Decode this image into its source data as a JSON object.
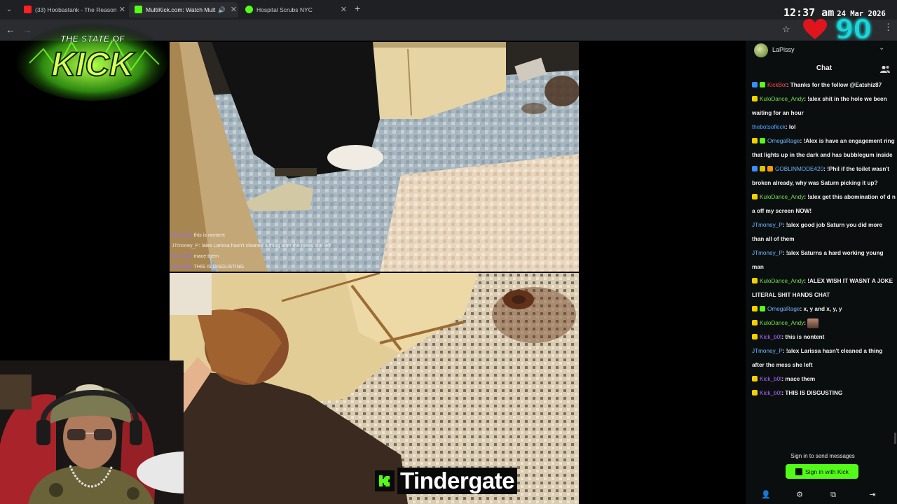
{
  "browser": {
    "tabs": [
      {
        "label": "(33) Hoobastank - The Reason",
        "favicon_color": "#ff2020"
      },
      {
        "label": "MultiKick.com: Watch Mult",
        "favicon_color": "#53fc18",
        "active": true
      },
      {
        "label": "Hospital Scrubs NYC",
        "favicon_color": "#53fc18"
      }
    ]
  },
  "overlay": {
    "time": "12:37 am",
    "date": "24 Mar 2026",
    "counter": "90"
  },
  "logo": {
    "line1": "THE STATE OF",
    "line2": "KICK"
  },
  "video_chat_overlay": [
    {
      "user": "Kick_b0t:",
      "text": "this is nontent"
    },
    {
      "user": "JTmoney_P:",
      "text": "!alex Larissa hasn't cleaned a thing after the mess she left"
    },
    {
      "user": "Kick_b0t:",
      "text": "mace them"
    },
    {
      "user": "Kick_b0t:",
      "text": "THIS IS DISGUSTING"
    }
  ],
  "stream_tag": "Tindergate",
  "chat": {
    "channel": "LaPissy",
    "title": "Chat",
    "messages": [
      {
        "user": "KickBot",
        "color": "red",
        "badges": [
          "b-blue",
          "b-green"
        ],
        "text": "Thanks for the follow @Eatshiz87"
      },
      {
        "user": "KuloDance_Andy",
        "color": "green",
        "badges": [
          "b-yellow"
        ],
        "text": "!alex shit in the hole we been waiting for an hour"
      },
      {
        "user": "thebotsofkick",
        "color": "blue",
        "badges": [],
        "text": "lol"
      },
      {
        "user": "OmegaRage",
        "color": "teal",
        "badges": [
          "b-yellow",
          "b-green"
        ],
        "text": "!Alex is have an engagement ring that lights up in the dark and has bubblegum inside"
      },
      {
        "user": "GOBLINMODE420",
        "color": "teal",
        "badges": [
          "b-blue",
          "b-gold",
          "b-orange"
        ],
        "text": "!Phil if the toilet wasn't broken already, why was Saturn picking it up?"
      },
      {
        "user": "KuloDance_Andy",
        "color": "green",
        "badges": [
          "b-yellow"
        ],
        "text": "!alex get this abomination of d n a off my screen NOW!"
      },
      {
        "user": "JTmoney_P",
        "color": "teal",
        "badges": [],
        "text": "!alex good job Saturn you did more than all of them"
      },
      {
        "user": "JTmoney_P",
        "color": "teal",
        "badges": [],
        "text": "!alex Saturns a hard working young man"
      },
      {
        "user": "KuloDance_Andy",
        "color": "green",
        "badges": [
          "b-yellow"
        ],
        "text": "!ALEX WISH IT WASNT A JOKE LITERAL SHIT HANDS CHAT"
      },
      {
        "user": "OmegaRage",
        "color": "teal",
        "badges": [
          "b-yellow",
          "b-green"
        ],
        "text": "x, y and x, y, y"
      },
      {
        "user": "KuloDance_Andy",
        "color": "green",
        "badges": [
          "b-yellow"
        ],
        "text": "",
        "emote": true
      },
      {
        "user": "Kick_b0t",
        "color": "purple",
        "badges": [
          "b-yellow"
        ],
        "text": "this is nontent"
      },
      {
        "user": "JTmoney_P",
        "color": "teal",
        "badges": [],
        "text": "!alex Larissa hasn't cleaned a thing after the mess she left"
      },
      {
        "user": "Kick_b0t",
        "color": "purple",
        "badges": [
          "b-yellow"
        ],
        "text": "mace them"
      },
      {
        "user": "Kick_b0t",
        "color": "purple",
        "badges": [
          "b-yellow"
        ],
        "text": "THIS IS DISGUSTING"
      }
    ],
    "signin_prompt": "Sign in to send messages",
    "signin_button": "Sign in with Kick"
  },
  "colors": {
    "kick_green": "#53fc18",
    "counter_cyan": "#21d3d6",
    "heart_red": "#e0141c"
  }
}
